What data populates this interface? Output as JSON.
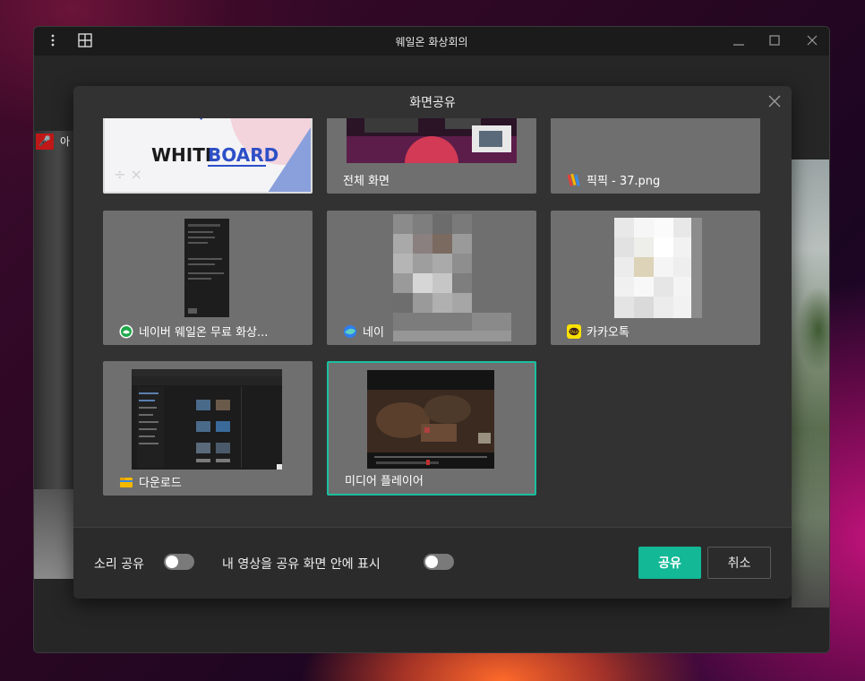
{
  "window": {
    "title": "웨일온 화상회의"
  },
  "participant": {
    "name": "아"
  },
  "dialog": {
    "title": "화면공유",
    "tiles": [
      {
        "label": "",
        "icon": "whiteboard-thumbnail",
        "thumb_text": "WHITEBOARD",
        "thumb_text_a": "WHITE",
        "thumb_text_b": "BOARD"
      },
      {
        "label": "전체 화면",
        "icon": "desktop-thumbnail"
      },
      {
        "label": "픽픽 - 37.png",
        "icon": "picpick-icon"
      },
      {
        "label": "네이버 웨일온 무료 화상...",
        "icon": "naver-whale-icon"
      },
      {
        "label": "네이",
        "icon": "whale-browser-icon"
      },
      {
        "label": "카카오톡",
        "icon": "kakaotalk-icon",
        "icon_text": "TALK"
      },
      {
        "label": "다운로드",
        "icon": "folder-icon"
      },
      {
        "label": "미디어 플레이어",
        "icon": "media-player-icon",
        "selected": true
      }
    ],
    "sound_share_label": "소리 공유",
    "show_my_video_label": "내 영상을 공유 화면 안에 표시",
    "share_button": "공유",
    "cancel_button": "취소"
  },
  "colors": {
    "accent": "#13b897",
    "selected_border": "#1bbfa0",
    "muted_badge": "#c01818",
    "kakao_yellow": "#fae100"
  }
}
